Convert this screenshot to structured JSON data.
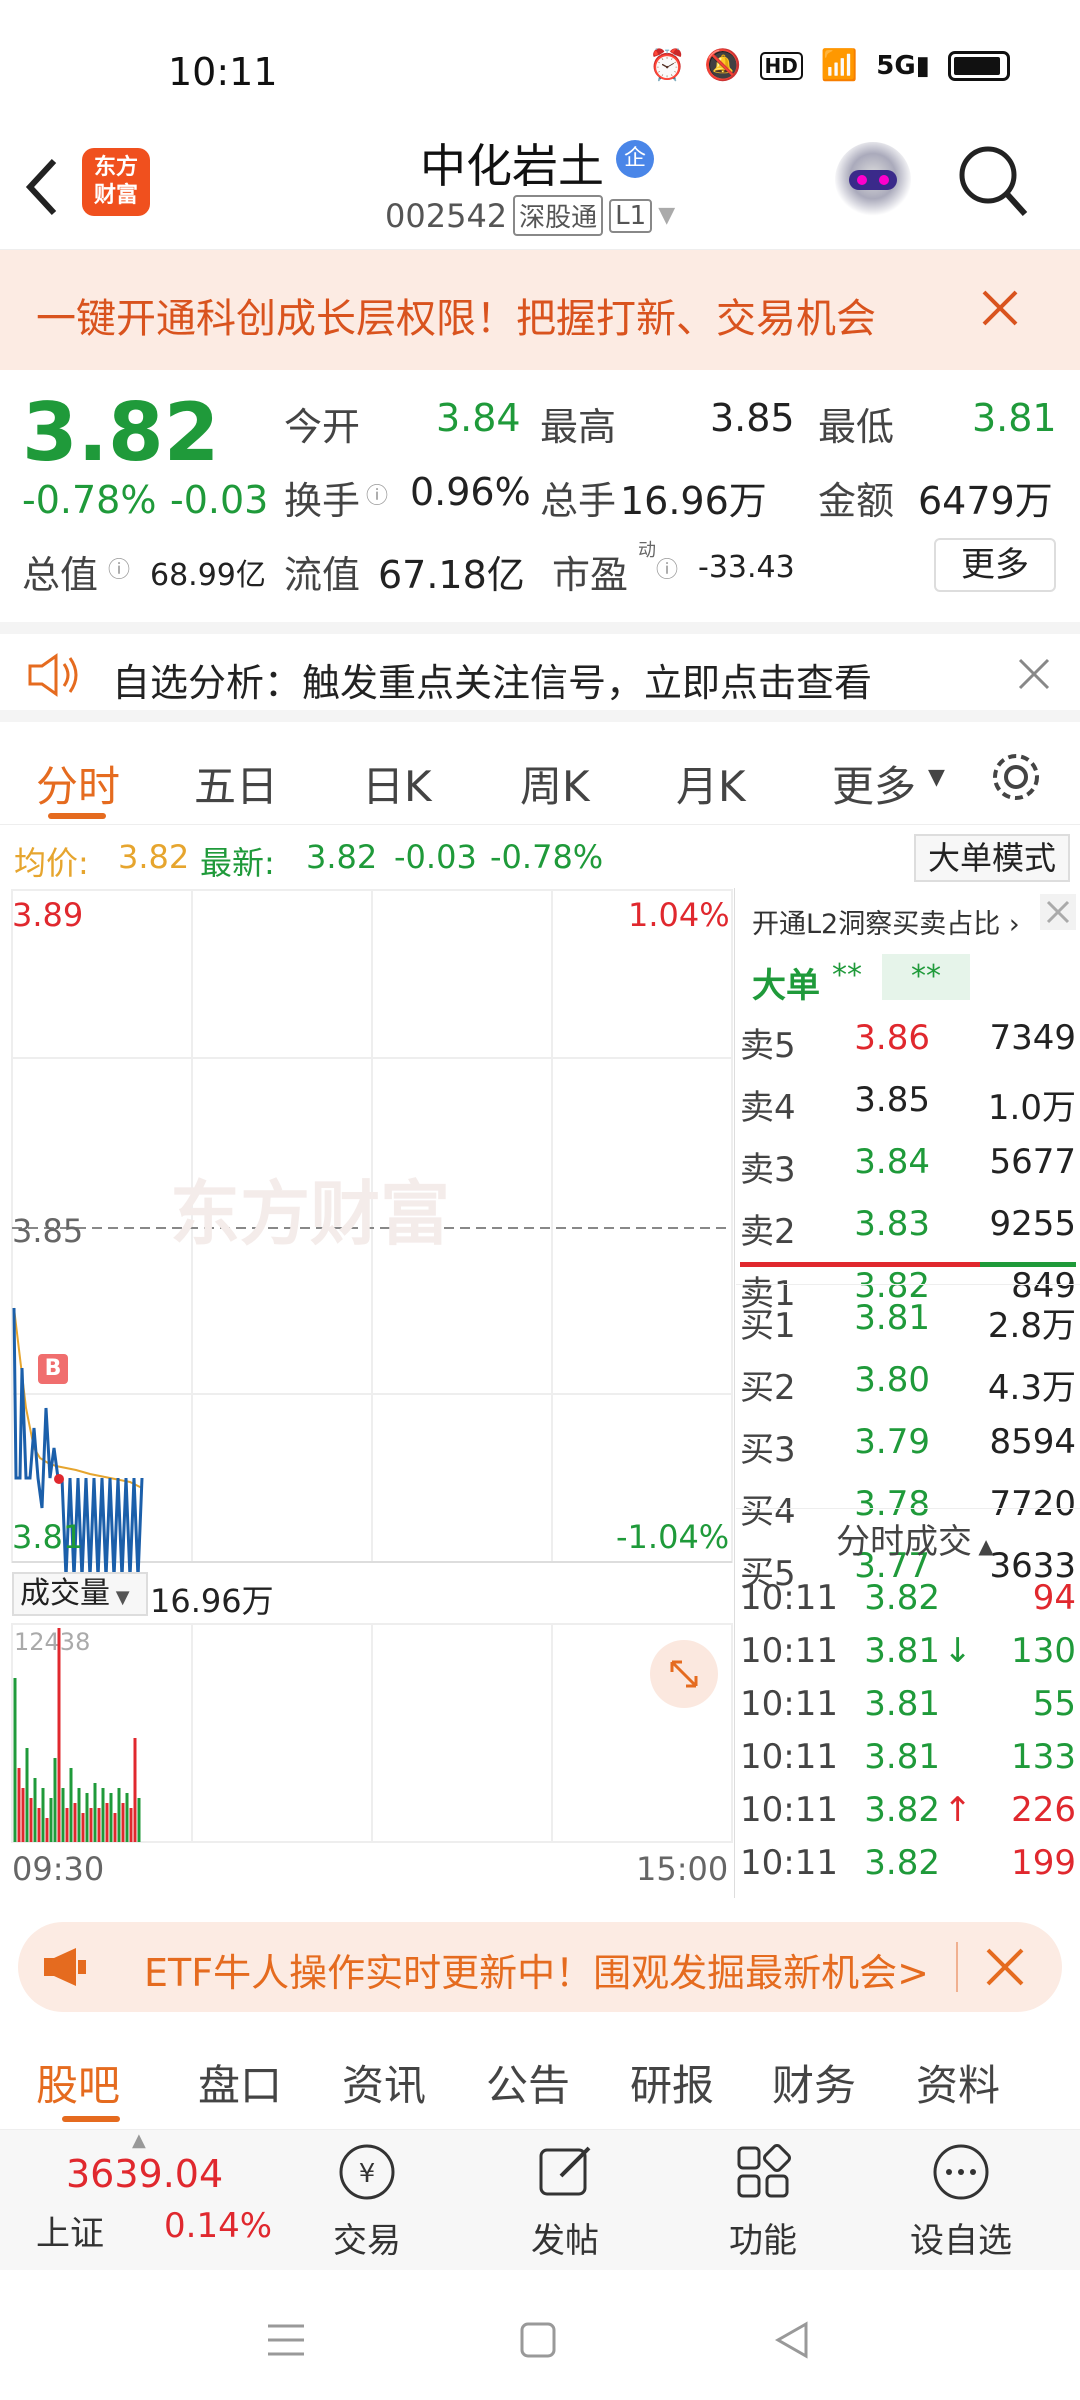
{
  "status": {
    "time": "10:11",
    "icons": [
      "alarm-icon",
      "mute-icon",
      "hd-icon",
      "wifi-icon",
      "5g-signal-icon",
      "battery-icon"
    ]
  },
  "header": {
    "back": "back-icon",
    "logo_text": "东方\n财富",
    "stock_name": "中化岩土",
    "badge": "企",
    "code": "002542",
    "tag1": "深股通",
    "tag2": "L1"
  },
  "banner": {
    "text": "一键开通科创成长层权限！把握打新、交易机会"
  },
  "quote": {
    "price": "3.82",
    "change_pct": "-0.78%",
    "change": "-0.03",
    "open_label": "今开",
    "open": "3.84",
    "high_label": "最高",
    "high": "3.85",
    "low_label": "最低",
    "low": "3.81",
    "turnover_label": "换手",
    "turnover": "0.96%",
    "volume_label": "总手",
    "volume": "16.96万",
    "amount_label": "金额",
    "amount": "6479万",
    "mktcap_label": "总值",
    "mktcap": "68.99亿",
    "float_label": "流值",
    "float": "67.18亿",
    "pe_label": "市盈",
    "pe_sup": "动",
    "pe": "-33.43",
    "more": "更多"
  },
  "notice": {
    "text": "自选分析：触发重点关注信号，立即点击查看"
  },
  "tabs": [
    "分时",
    "五日",
    "日K",
    "周K",
    "月K",
    "更多"
  ],
  "avg": {
    "avg_label": "均价:",
    "avg": "3.82",
    "latest_label": "最新:",
    "latest": "3.82",
    "chg": "-0.03",
    "pct": "-0.78%",
    "mode": "大单模式"
  },
  "chart": {
    "top_price": "3.89",
    "top_pct": "1.04%",
    "mid_price": "3.85",
    "bottom_price": "3.81",
    "bottom_pct": "-1.04%",
    "watermark": "东方财富",
    "marker": "B",
    "vol_label": "成交量",
    "vol_value": "16.96万",
    "vol_max": "12438",
    "time_start": "09:30",
    "time_end": "15:00"
  },
  "orderbook": {
    "title": "开通L2洞察买卖占比",
    "big_label": "大单",
    "big_v1": "**",
    "big_v2": "**",
    "asks": [
      {
        "label": "卖5",
        "price": "3.86",
        "vol": "7349",
        "color": "red"
      },
      {
        "label": "卖4",
        "price": "3.85",
        "vol": "1.0万",
        "color": "black"
      },
      {
        "label": "卖3",
        "price": "3.84",
        "vol": "5677",
        "color": "green"
      },
      {
        "label": "卖2",
        "price": "3.83",
        "vol": "9255",
        "color": "green"
      },
      {
        "label": "卖1",
        "price": "3.82",
        "vol": "849",
        "color": "green"
      }
    ],
    "bids": [
      {
        "label": "买1",
        "price": "3.81",
        "vol": "2.8万",
        "color": "green"
      },
      {
        "label": "买2",
        "price": "3.80",
        "vol": "4.3万",
        "color": "green"
      },
      {
        "label": "买3",
        "price": "3.79",
        "vol": "8594",
        "color": "green"
      },
      {
        "label": "买4",
        "price": "3.78",
        "vol": "7720",
        "color": "green"
      },
      {
        "label": "买5",
        "price": "3.77",
        "vol": "3633",
        "color": "green"
      }
    ],
    "trades_title": "分时成交",
    "trades": [
      {
        "time": "10:11",
        "price": "3.82",
        "arrow": "",
        "vol": "94",
        "pcolor": "green",
        "vcolor": "red"
      },
      {
        "time": "10:11",
        "price": "3.81",
        "arrow": "↓",
        "vol": "130",
        "pcolor": "green",
        "vcolor": "green"
      },
      {
        "time": "10:11",
        "price": "3.81",
        "arrow": "",
        "vol": "55",
        "pcolor": "green",
        "vcolor": "green"
      },
      {
        "time": "10:11",
        "price": "3.81",
        "arrow": "",
        "vol": "133",
        "pcolor": "green",
        "vcolor": "green"
      },
      {
        "time": "10:11",
        "price": "3.82",
        "arrow": "↑",
        "vol": "226",
        "pcolor": "green",
        "vcolor": "red"
      },
      {
        "time": "10:11",
        "price": "3.82",
        "arrow": "",
        "vol": "199",
        "pcolor": "green",
        "vcolor": "red"
      }
    ]
  },
  "etf": {
    "text": "ETF牛人操作实时更新中！围观发掘最新机会>"
  },
  "bottom_tabs": [
    "股吧",
    "盘口",
    "资讯",
    "公告",
    "研报",
    "财务",
    "资料"
  ],
  "toolbar": {
    "index_value": "3639.04",
    "index_name": "上证",
    "index_pct": "0.14%",
    "trade": "交易",
    "post": "发帖",
    "func": "功能",
    "watch": "设自选"
  }
}
